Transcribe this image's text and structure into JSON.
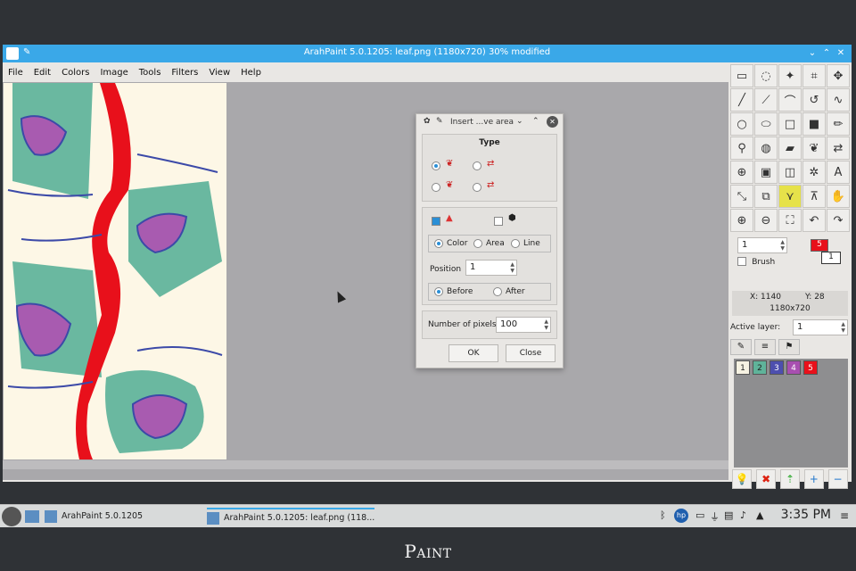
{
  "window": {
    "title": "ArahPaint 5.0.1205: leaf.png  (1180x720) 30% modified"
  },
  "menu": [
    "File",
    "Edit",
    "Colors",
    "Image",
    "Tools",
    "Filters",
    "View",
    "Help"
  ],
  "dialog": {
    "title": "Insert ...ve area",
    "type_label": "Type",
    "mode_options": [
      "Color",
      "Area",
      "Line"
    ],
    "mode_selected": "Color",
    "position_label": "Position",
    "position_value": "1",
    "placement_options": [
      "Before",
      "After"
    ],
    "placement_selected": "Before",
    "pixels_label": "Number of pixels",
    "pixels_value": "100",
    "ok_label": "OK",
    "close_label": "Close"
  },
  "right_panel": {
    "brush_size_value": "1",
    "brush_label": "Brush",
    "fg_color_label": "5",
    "bg_color_label": "1",
    "x_label": "X: 1140",
    "y_label": "Y: 28",
    "size_label": "1180x720",
    "active_layer_label": "Active layer:",
    "active_layer_value": "1",
    "layers": [
      {
        "label": "1",
        "color": "#f6f2e2"
      },
      {
        "label": "2",
        "color": "#5fb39a"
      },
      {
        "label": "3",
        "color": "#4d4fae"
      },
      {
        "label": "4",
        "color": "#a84fb0"
      },
      {
        "label": "5",
        "color": "#e8101b"
      }
    ]
  },
  "taskbar": {
    "item1": "ArahPaint 5.0.1205",
    "item2": "ArahPaint 5.0.1205: leaf.png  (118...",
    "clock": "3:35 PM"
  },
  "caption": "Paint",
  "colors": {
    "titlebar": "#3aa8e8",
    "accent_red": "#e8101b",
    "teal": "#5fb39a",
    "purple": "#4d4fae"
  }
}
